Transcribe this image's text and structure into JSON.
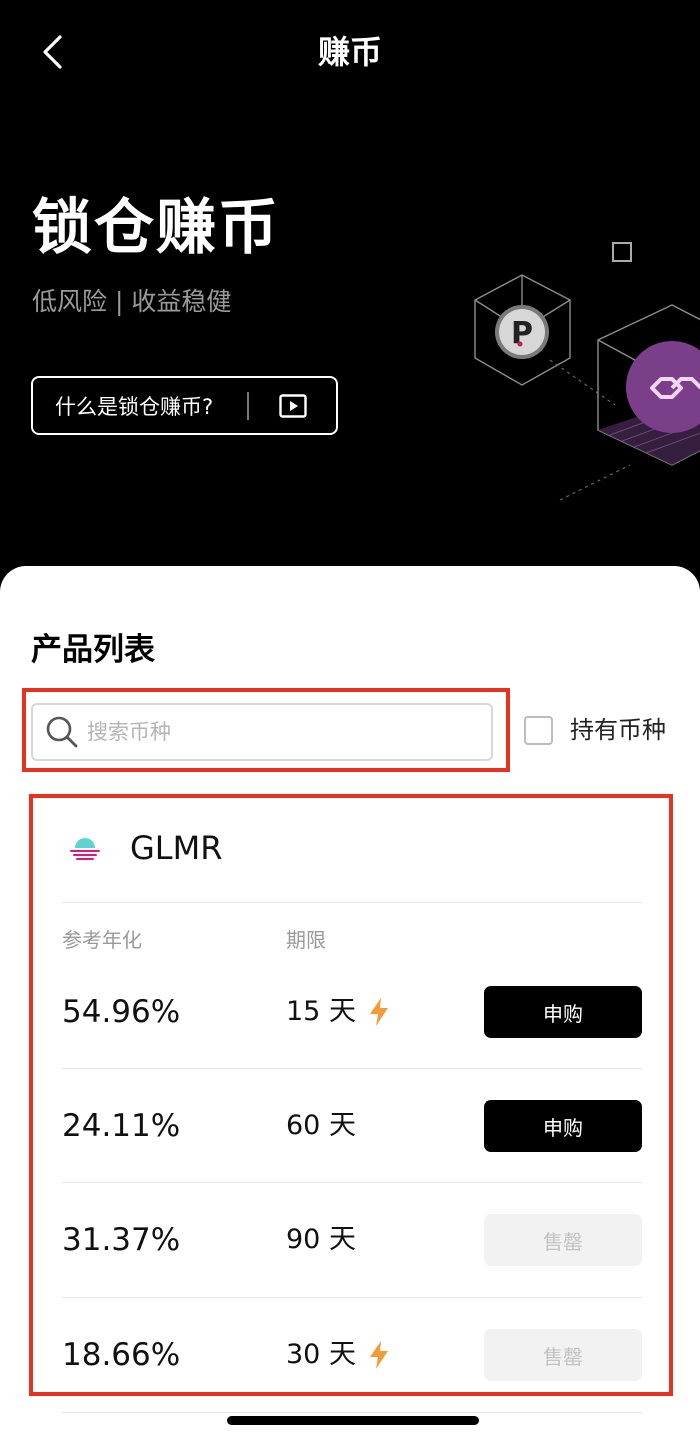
{
  "nav": {
    "title": "赚币",
    "back_icon": "chevron-left-icon"
  },
  "hero": {
    "title": "锁仓赚币",
    "subtitle": "低风险 | 收益稳健",
    "what_button_label": "什么是锁仓赚币?",
    "play_icon": "play-video-icon"
  },
  "products": {
    "section_title": "产品列表",
    "search": {
      "placeholder": "搜索币种",
      "value": ""
    },
    "hold_filter_label": "持有币种",
    "coin": {
      "name": "GLMR",
      "logo_icon": "glmr-logo-icon"
    },
    "columns": {
      "rate": "参考年化",
      "term": "期限"
    },
    "rows": [
      {
        "rate": "54.96%",
        "term": "15 天",
        "flash": true,
        "action": "申购",
        "sold_out": false
      },
      {
        "rate": "24.11%",
        "term": "60 天",
        "flash": false,
        "action": "申购",
        "sold_out": false
      },
      {
        "rate": "31.37%",
        "term": "90 天",
        "flash": false,
        "action": "售罄",
        "sold_out": true
      },
      {
        "rate": "18.66%",
        "term": "30 天",
        "flash": true,
        "action": "售罄",
        "sold_out": true
      }
    ]
  },
  "colors": {
    "highlight": "#e8321f",
    "accent_flash": "#f29b38",
    "illustration_purple": "#7b3f8a"
  }
}
